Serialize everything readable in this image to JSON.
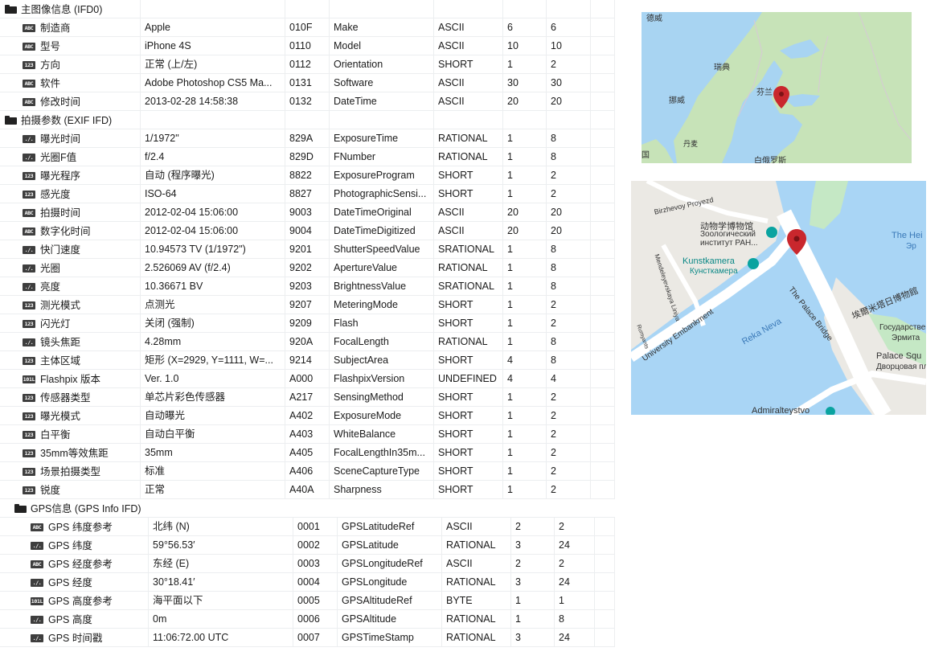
{
  "sections": [
    {
      "title": "主图像信息 (IFD0)",
      "indent": false,
      "rows": [
        {
          "icon": "ABC",
          "name": "制造商",
          "value": "Apple",
          "tag": "010F",
          "key": "Make",
          "type": "ASCII",
          "count": "6",
          "size": "6"
        },
        {
          "icon": "ABC",
          "name": "型号",
          "value": "iPhone 4S",
          "tag": "0110",
          "key": "Model",
          "type": "ASCII",
          "count": "10",
          "size": "10"
        },
        {
          "icon": "123",
          "name": "方向",
          "value": "正常 (上/左)",
          "tag": "0112",
          "key": "Orientation",
          "type": "SHORT",
          "count": "1",
          "size": "2"
        },
        {
          "icon": "ABC",
          "name": "软件",
          "value": "Adobe Photoshop CS5 Ma...",
          "tag": "0131",
          "key": "Software",
          "type": "ASCII",
          "count": "30",
          "size": "30"
        },
        {
          "icon": "ABC",
          "name": "修改时间",
          "value": "2013-02-28 14:58:38",
          "tag": "0132",
          "key": "DateTime",
          "type": "ASCII",
          "count": "20",
          "size": "20"
        }
      ]
    },
    {
      "title": "拍摄参数 (EXIF IFD)",
      "indent": false,
      "rows": [
        {
          "icon": "./.",
          "name": "曝光时间",
          "value": "1/1972\"",
          "tag": "829A",
          "key": "ExposureTime",
          "type": "RATIONAL",
          "count": "1",
          "size": "8"
        },
        {
          "icon": "./.",
          "name": "光圈F值",
          "value": "f/2.4",
          "tag": "829D",
          "key": "FNumber",
          "type": "RATIONAL",
          "count": "1",
          "size": "8"
        },
        {
          "icon": "123",
          "name": "曝光程序",
          "value": "自动 (程序曝光)",
          "tag": "8822",
          "key": "ExposureProgram",
          "type": "SHORT",
          "count": "1",
          "size": "2"
        },
        {
          "icon": "123",
          "name": "感光度",
          "value": "ISO-64",
          "tag": "8827",
          "key": "PhotographicSensi...",
          "type": "SHORT",
          "count": "1",
          "size": "2"
        },
        {
          "icon": "ABC",
          "name": "拍摄时间",
          "value": "2012-02-04 15:06:00",
          "tag": "9003",
          "key": "DateTimeOriginal",
          "type": "ASCII",
          "count": "20",
          "size": "20"
        },
        {
          "icon": "ABC",
          "name": "数字化时间",
          "value": "2012-02-04 15:06:00",
          "tag": "9004",
          "key": "DateTimeDigitized",
          "type": "ASCII",
          "count": "20",
          "size": "20"
        },
        {
          "icon": "./.",
          "name": "快门速度",
          "value": "10.94573 TV (1/1972\")",
          "tag": "9201",
          "key": "ShutterSpeedValue",
          "type": "SRATIONAL",
          "count": "1",
          "size": "8"
        },
        {
          "icon": "./.",
          "name": "光圈",
          "value": "2.526069 AV (f/2.4)",
          "tag": "9202",
          "key": "ApertureValue",
          "type": "RATIONAL",
          "count": "1",
          "size": "8"
        },
        {
          "icon": "./.",
          "name": "亮度",
          "value": "10.36671 BV",
          "tag": "9203",
          "key": "BrightnessValue",
          "type": "SRATIONAL",
          "count": "1",
          "size": "8"
        },
        {
          "icon": "123",
          "name": "测光模式",
          "value": "点测光",
          "tag": "9207",
          "key": "MeteringMode",
          "type": "SHORT",
          "count": "1",
          "size": "2"
        },
        {
          "icon": "123",
          "name": "闪光灯",
          "value": "关闭 (强制)",
          "tag": "9209",
          "key": "Flash",
          "type": "SHORT",
          "count": "1",
          "size": "2"
        },
        {
          "icon": "./.",
          "name": "镜头焦距",
          "value": "4.28mm",
          "tag": "920A",
          "key": "FocalLength",
          "type": "RATIONAL",
          "count": "1",
          "size": "8"
        },
        {
          "icon": "123",
          "name": "主体区域",
          "value": "矩形 (X=2929, Y=1111, W=...",
          "tag": "9214",
          "key": "SubjectArea",
          "type": "SHORT",
          "count": "4",
          "size": "8"
        },
        {
          "icon": "101L",
          "name": "Flashpix 版本",
          "value": "Ver. 1.0",
          "tag": "A000",
          "key": "FlashpixVersion",
          "type": "UNDEFINED",
          "count": "4",
          "size": "4"
        },
        {
          "icon": "123",
          "name": "传感器类型",
          "value": "单芯片彩色传感器",
          "tag": "A217",
          "key": "SensingMethod",
          "type": "SHORT",
          "count": "1",
          "size": "2"
        },
        {
          "icon": "123",
          "name": "曝光模式",
          "value": "自动曝光",
          "tag": "A402",
          "key": "ExposureMode",
          "type": "SHORT",
          "count": "1",
          "size": "2"
        },
        {
          "icon": "123",
          "name": "白平衡",
          "value": "自动白平衡",
          "tag": "A403",
          "key": "WhiteBalance",
          "type": "SHORT",
          "count": "1",
          "size": "2"
        },
        {
          "icon": "123",
          "name": "35mm等效焦距",
          "value": "35mm",
          "tag": "A405",
          "key": "FocalLengthIn35m...",
          "type": "SHORT",
          "count": "1",
          "size": "2"
        },
        {
          "icon": "123",
          "name": "场景拍摄类型",
          "value": "标准",
          "tag": "A406",
          "key": "SceneCaptureType",
          "type": "SHORT",
          "count": "1",
          "size": "2"
        },
        {
          "icon": "123",
          "name": "锐度",
          "value": "正常",
          "tag": "A40A",
          "key": "Sharpness",
          "type": "SHORT",
          "count": "1",
          "size": "2"
        }
      ]
    },
    {
      "title": "GPS信息 (GPS Info IFD)",
      "indent": true,
      "rows": [
        {
          "icon": "ABC",
          "name": "GPS 纬度参考",
          "value": "北纬 (N)",
          "tag": "0001",
          "key": "GPSLatitudeRef",
          "type": "ASCII",
          "count": "2",
          "size": "2"
        },
        {
          "icon": "./.",
          "name": "GPS 纬度",
          "value": "59°56.53′",
          "tag": "0002",
          "key": "GPSLatitude",
          "type": "RATIONAL",
          "count": "3",
          "size": "24"
        },
        {
          "icon": "ABC",
          "name": "GPS 经度参考",
          "value": "东经 (E)",
          "tag": "0003",
          "key": "GPSLongitudeRef",
          "type": "ASCII",
          "count": "2",
          "size": "2"
        },
        {
          "icon": "./.",
          "name": "GPS 经度",
          "value": "30°18.41′",
          "tag": "0004",
          "key": "GPSLongitude",
          "type": "RATIONAL",
          "count": "3",
          "size": "24"
        },
        {
          "icon": "101L",
          "name": "GPS 高度参考",
          "value": "海平面以下",
          "tag": "0005",
          "key": "GPSAltitudeRef",
          "type": "BYTE",
          "count": "1",
          "size": "1"
        },
        {
          "icon": "./.",
          "name": "GPS 高度",
          "value": "0m",
          "tag": "0006",
          "key": "GPSAltitude",
          "type": "RATIONAL",
          "count": "1",
          "size": "8"
        },
        {
          "icon": "./.",
          "name": "GPS 时间戳",
          "value": "11:06:72.00 UTC",
          "tag": "0007",
          "key": "GPSTimeStamp",
          "type": "RATIONAL",
          "count": "3",
          "size": "24"
        }
      ]
    }
  ],
  "map_overview": {
    "labels": [
      "挪威",
      "瑞典",
      "芬兰",
      "德威",
      "丹麦",
      "白俄罗斯",
      "国"
    ],
    "colors": {
      "water": "#a8d4f2",
      "land": "#c7e3b8",
      "marker": "#c9272d"
    }
  },
  "map_detail": {
    "labels": [
      "Birzhevoy Proyezd",
      "动物学博物馆",
      "Зоологический",
      "институт РАН...",
      "Kunstkamera",
      "Кунсткамера",
      "The Palace Bridge",
      "Mendeleyevskaya Liniya",
      "University Embankment",
      "Reka Neva",
      "埃爾米塔日博物館",
      "Государственны",
      "Эрмита",
      "Palace Squ",
      "Дворцовая площ",
      "The Hei",
      "Эр",
      "Admiralteystvo",
      "Rumyants"
    ],
    "colors": {
      "water": "#a9d5f5",
      "land": "#ebe9e4",
      "road": "#ffffff",
      "park": "#c5e8c5",
      "marker": "#c9272d",
      "poi": "#0aa3a0"
    }
  }
}
